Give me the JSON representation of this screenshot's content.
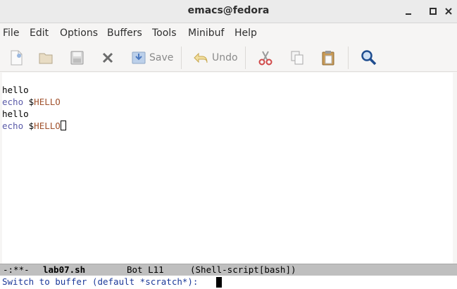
{
  "window": {
    "title": "emacs@fedora"
  },
  "menu": {
    "items": [
      {
        "label": "File"
      },
      {
        "label": "Edit"
      },
      {
        "label": "Options"
      },
      {
        "label": "Buffers"
      },
      {
        "label": "Tools"
      },
      {
        "label": "Minibuf"
      },
      {
        "label": "Help"
      }
    ]
  },
  "toolbar": {
    "save_label": "Save",
    "undo_label": "Undo",
    "icons": [
      "new-file-icon",
      "open-folder-icon",
      "disk-icon",
      "close-icon",
      "save-icon",
      "undo-icon",
      "cut-icon",
      "copy-icon",
      "paste-icon",
      "search-icon"
    ]
  },
  "editor": {
    "lines": [
      {
        "text": "hello"
      },
      {
        "keyword": "echo",
        "plain": " $",
        "var": "HELLO"
      },
      {
        "text": "hello"
      },
      {
        "keyword": "echo",
        "plain": " $",
        "var": "HELLO"
      }
    ]
  },
  "modeline": {
    "status": "-:**-",
    "buffer_name": "lab07.sh",
    "position": "Bot L11",
    "mode": "(Shell-script[bash])"
  },
  "minibuffer": {
    "prompt": "Switch to buffer (default *scratch*): "
  },
  "colors": {
    "keyword": "#5a5aa8",
    "variable": "#a0522d",
    "prompt": "#1c3a9a",
    "modeline_bg": "#bfbfbf"
  }
}
